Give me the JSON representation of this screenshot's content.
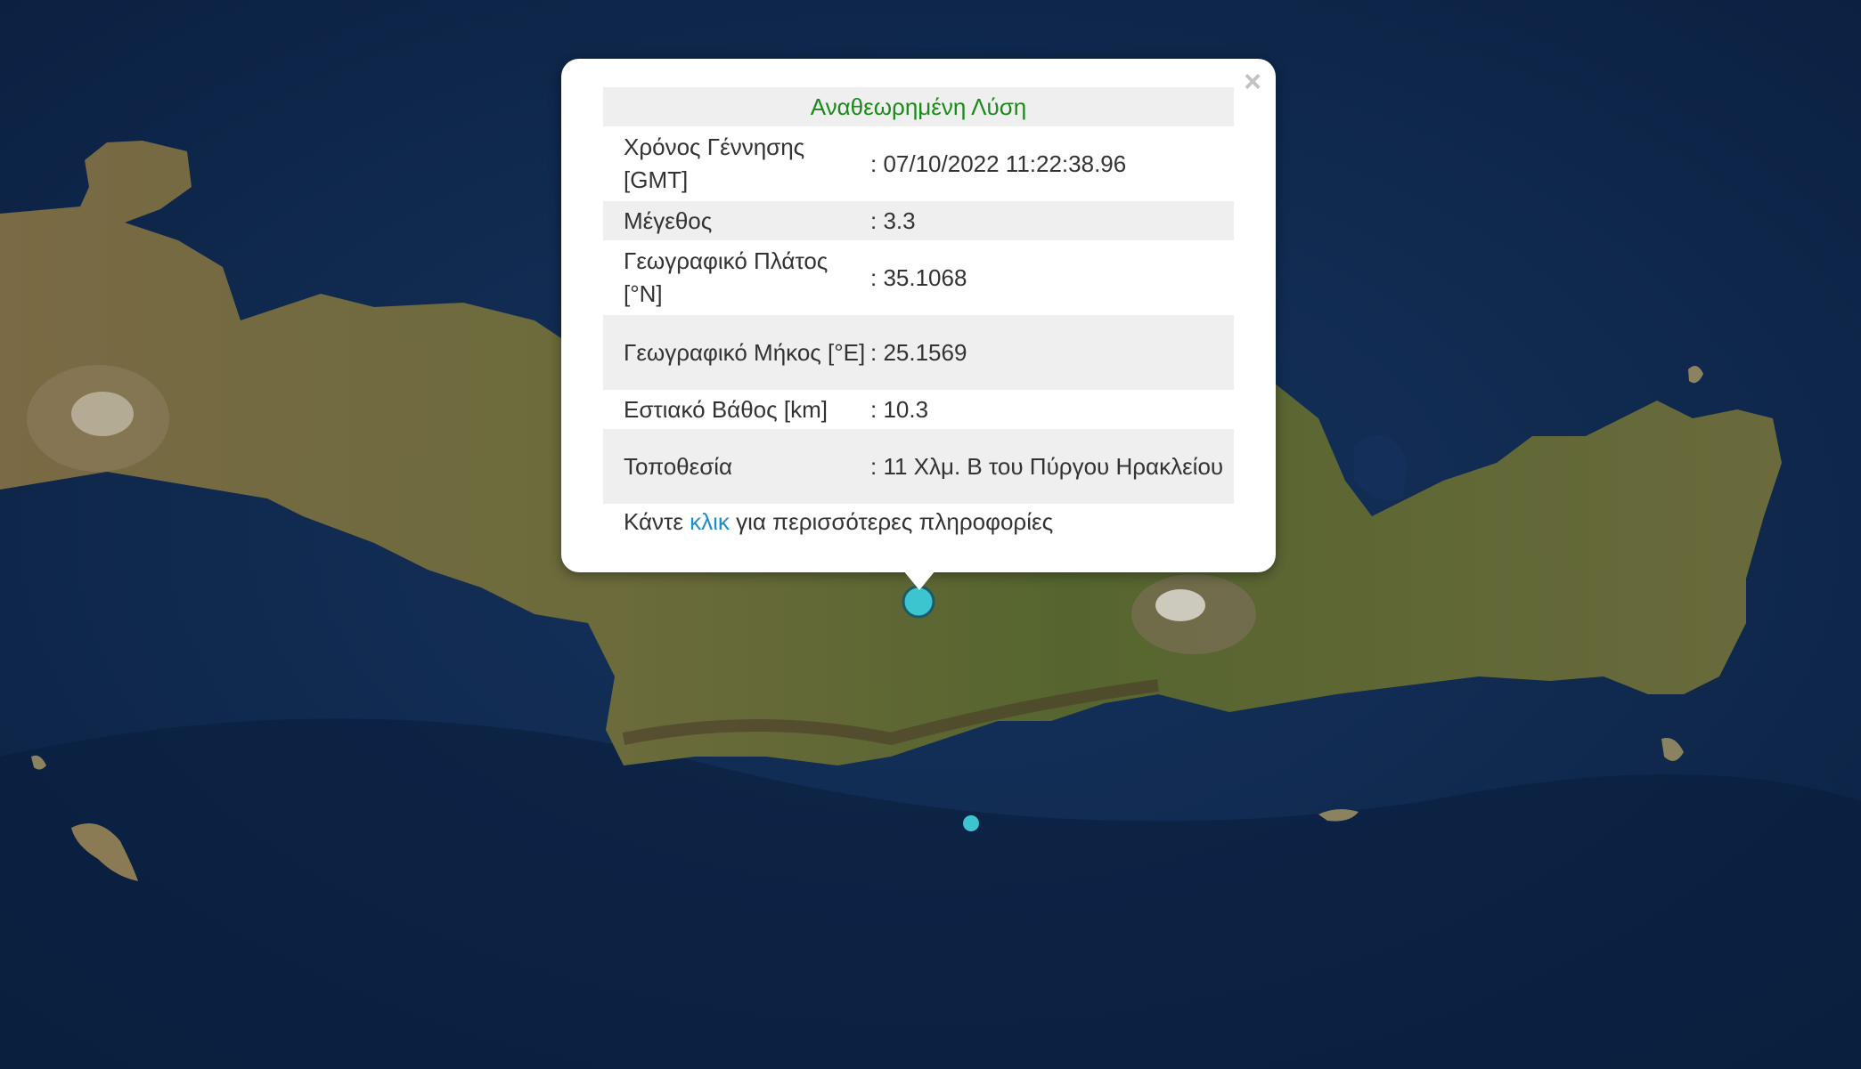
{
  "popup": {
    "header": "Αναθεωρημένη Λύση",
    "close_icon": "×",
    "rows": [
      {
        "label": "Χρόνος Γέννησης [GMT]",
        "value": ": 07/10/2022 11:22:38.96"
      },
      {
        "label": "Μέγεθος",
        "value": ": 3.3"
      },
      {
        "label": "Γεωγραφικό Πλάτος [°N]",
        "value": ": 35.1068"
      },
      {
        "label": "Γεωγραφικό Μήκος [°E]",
        "value": ": 25.1569"
      },
      {
        "label": "Εστιακό Βάθος [km]",
        "value": ": 10.3"
      },
      {
        "label": "Τοποθεσία",
        "value": ": 11 Χλμ. Β του Πύργου Ηρακλείου"
      }
    ],
    "more_prefix": "Κάντε ",
    "more_link": "κλικ",
    "more_suffix": " για περισσότερες πληροφορίες"
  },
  "map": {
    "sea_color": "#0d2a52",
    "land_color": "#6e6a3c",
    "marker_color": "#3cc4cf"
  }
}
